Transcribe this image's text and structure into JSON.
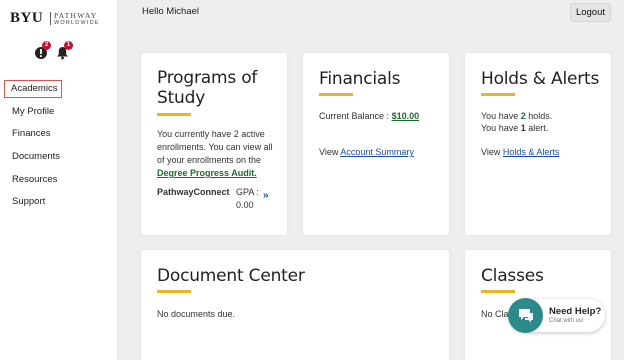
{
  "logo": {
    "brand": "BYU",
    "line1": "PATHWAY",
    "line2": "WORLDWIDE"
  },
  "notifications": {
    "info_count": "2",
    "bell_count": "1"
  },
  "sidebar": {
    "items": [
      {
        "label": "Academics",
        "active": true
      },
      {
        "label": "My Profile"
      },
      {
        "label": "Finances"
      },
      {
        "label": "Documents"
      },
      {
        "label": "Resources"
      },
      {
        "label": "Support"
      }
    ]
  },
  "header": {
    "greeting": "Hello Michael",
    "logout": "Logout"
  },
  "programs": {
    "title": "Programs of Study",
    "text": "You currently have 2 active enrollments. You can view all of your enrollments on the",
    "link": "Degree Progress Audit.",
    "program_name": "PathwayConnect",
    "gpa_label": "GPA :",
    "gpa_value": "0.00",
    "more": "»"
  },
  "financials": {
    "title": "Financials",
    "balance_label": "Current Balance :",
    "balance_value": "$10.00",
    "view_label": "View",
    "view_link": "Account Summary"
  },
  "holds": {
    "title": "Holds & Alerts",
    "holds_pre": "You have",
    "holds_count": "2",
    "holds_post": "holds.",
    "alerts_pre": "You have",
    "alerts_count": "1",
    "alerts_post": "alert.",
    "view_label": "View",
    "view_link": "Holds & Alerts"
  },
  "documents": {
    "title": "Document Center",
    "text": "No documents due."
  },
  "classes": {
    "title": "Classes",
    "text": "No Clas"
  },
  "help": {
    "title": "Need Help?",
    "subtitle": "Chat with us!"
  },
  "colors": {
    "accent": "#f0b323",
    "link": "#1a4f9c",
    "green_link": "#1d6b2b",
    "badge": "#c8102e",
    "chat": "#2d8a8a"
  }
}
